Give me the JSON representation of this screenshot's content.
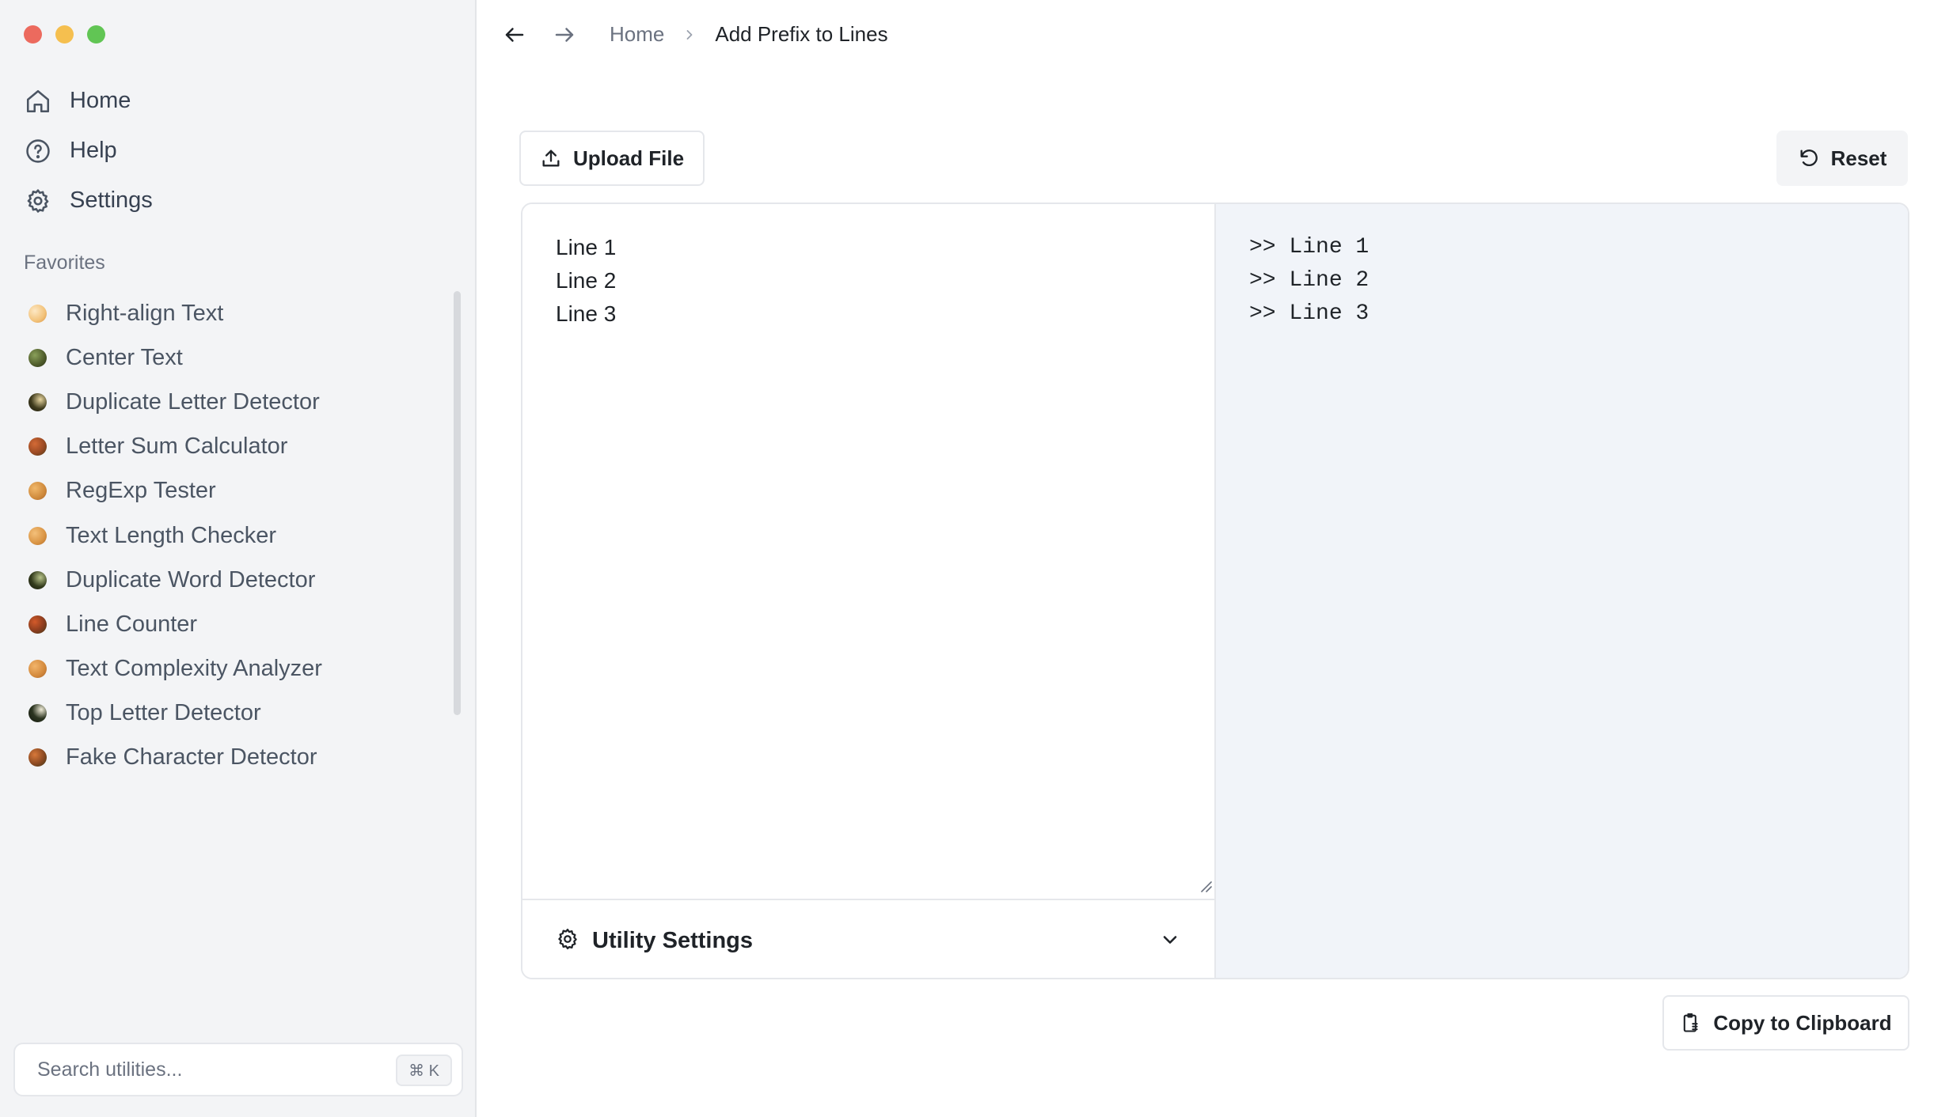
{
  "sidebar": {
    "nav": [
      {
        "label": "Home",
        "icon": "home-icon"
      },
      {
        "label": "Help",
        "icon": "help-icon"
      },
      {
        "label": "Settings",
        "icon": "gear-icon"
      }
    ],
    "favorites_title": "Favorites",
    "favorites": [
      {
        "label": "Right-align Text",
        "color": "#f2c27a"
      },
      {
        "label": "Center Text",
        "color": "#4d5a2a"
      },
      {
        "label": "Duplicate Letter Detector",
        "color": "#3e3a1c"
      },
      {
        "label": "Letter Sum Calculator",
        "color": "#9b4a24"
      },
      {
        "label": "RegExp Tester",
        "color": "#cf8a3c"
      },
      {
        "label": "Text Length Checker",
        "color": "#d99444"
      },
      {
        "label": "Duplicate Word Detector",
        "color": "#333b1c"
      },
      {
        "label": "Line Counter",
        "color": "#8a3c1e"
      },
      {
        "label": "Text Complexity Analyzer",
        "color": "#d3893c"
      },
      {
        "label": "Top Letter Detector",
        "color": "#2b3420"
      },
      {
        "label": "Fake Character Detector",
        "color": "#8c4a22"
      }
    ],
    "search": {
      "placeholder": "Search utilities...",
      "shortcut": "⌘ K"
    }
  },
  "breadcrumb": {
    "home": "Home",
    "current": "Add Prefix to Lines"
  },
  "toolbar": {
    "upload_label": "Upload File",
    "reset_label": "Reset"
  },
  "editor": {
    "input": "Line 1\nLine 2\nLine 3",
    "output": ">> Line 1\n>> Line 2\n>> Line 3",
    "settings_label": "Utility Settings"
  },
  "copy_label": "Copy to Clipboard"
}
